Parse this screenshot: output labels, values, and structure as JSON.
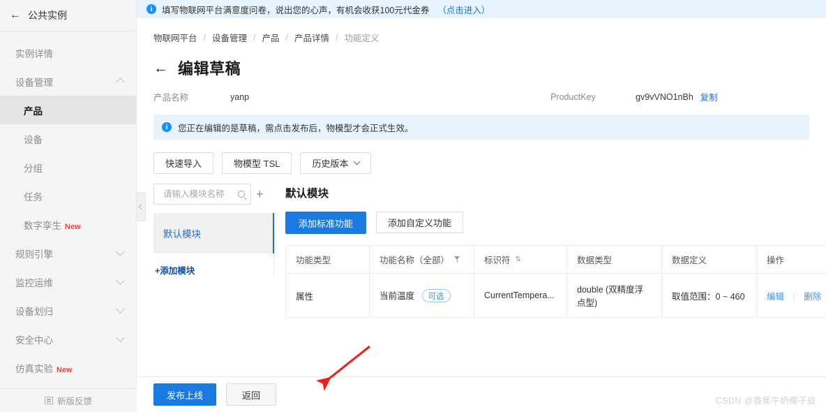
{
  "sidebar": {
    "back_icon": "arrow-left-icon",
    "header_title": "公共实例",
    "items": [
      {
        "label": "实例详情",
        "icon": "",
        "badge": "",
        "state": "normal",
        "expander": ""
      },
      {
        "label": "设备管理",
        "icon": "",
        "badge": "",
        "state": "normal",
        "expander": "chevron-up-icon"
      },
      {
        "label": "产品",
        "icon": "",
        "badge": "",
        "state": "active",
        "expander": "",
        "sub": true
      },
      {
        "label": "设备",
        "icon": "",
        "badge": "",
        "state": "normal",
        "expander": "",
        "sub": true
      },
      {
        "label": "分组",
        "icon": "",
        "badge": "",
        "state": "normal",
        "expander": "",
        "sub": true
      },
      {
        "label": "任务",
        "icon": "",
        "badge": "",
        "state": "normal",
        "expander": "",
        "sub": true
      },
      {
        "label": "数字孪生",
        "icon": "",
        "badge": "New",
        "state": "normal",
        "expander": "",
        "sub": true
      },
      {
        "label": "规则引擎",
        "icon": "",
        "badge": "",
        "state": "normal",
        "expander": "chevron-down-icon"
      },
      {
        "label": "监控运维",
        "icon": "",
        "badge": "",
        "state": "normal",
        "expander": "chevron-down-icon"
      },
      {
        "label": "设备划归",
        "icon": "",
        "badge": "",
        "state": "normal",
        "expander": "chevron-down-icon"
      },
      {
        "label": "安全中心",
        "icon": "",
        "badge": "",
        "state": "normal",
        "expander": "chevron-down-icon"
      },
      {
        "label": "仿真实验",
        "icon": "",
        "badge": "New",
        "state": "normal",
        "expander": ""
      }
    ],
    "footer": {
      "icon": "feedback-icon",
      "label": "新版反馈"
    }
  },
  "top_notice": {
    "icon": "info-circle-icon",
    "text": "填写物联网平台满意度问卷，说出您的心声，有机会收获100元代金券",
    "link": "（点击进入）",
    "bg_color": "#e8f4fd",
    "link_color": "#1a6fd4"
  },
  "breadcrumb": {
    "separator": "/",
    "items": [
      "物联网平台",
      "设备管理",
      "产品",
      "产品详情",
      "功能定义"
    ]
  },
  "page": {
    "back_icon": "arrow-left-icon",
    "title": "编辑草稿"
  },
  "product_info": {
    "name_label": "产品名称",
    "name_value": "yanp",
    "key_label": "ProductKey",
    "key_value": "gv9vVNO1nBh",
    "copy_label": "复制"
  },
  "draft_notice": {
    "icon": "info-circle-icon",
    "text": "您正在编辑的是草稿，需点击发布后，物模型才会正式生效。"
  },
  "toolbar": {
    "buttons": [
      {
        "label": "快速导入",
        "has_chevron": false
      },
      {
        "label": "物模型 TSL",
        "has_chevron": false
      },
      {
        "label": "历史版本",
        "has_chevron": true
      }
    ]
  },
  "module_pane": {
    "search_placeholder": "请输入模块名称",
    "search_value": "",
    "search_icon": "search-icon",
    "add_icon": "plus-icon",
    "modules": [
      "默认模块"
    ],
    "add_module_label": "+添加模块",
    "collapse_icon": "chevron-left-icon"
  },
  "function_pane": {
    "title": "默认模块",
    "primary_button": "添加标准功能",
    "secondary_button": "添加自定义功能",
    "accent_color": "#1a7ae0",
    "table": {
      "columns": [
        {
          "label": "功能类型",
          "icon": ""
        },
        {
          "label": "功能名称（全部）",
          "icon": "filter-icon"
        },
        {
          "label": "标识符",
          "icon": "sort-icon"
        },
        {
          "label": "数据类型",
          "icon": ""
        },
        {
          "label": "数据定义",
          "icon": ""
        },
        {
          "label": "操作",
          "icon": ""
        }
      ],
      "rows": [
        {
          "type": "属性",
          "name": "当前温度",
          "tag": "可选",
          "identifier": "CurrentTempera...",
          "data_type": "double (双精度浮点型)",
          "data_def": "取值范围：0 ~ 460",
          "actions": [
            "编辑",
            "删除"
          ]
        }
      ]
    }
  },
  "footer_actions": {
    "publish_label": "发布上线",
    "back_label": "返回"
  },
  "annotation": {
    "arrow_color": "#e8231b"
  },
  "watermark": {
    "text": "CSDN @香蕉牛奶椰子皮"
  }
}
